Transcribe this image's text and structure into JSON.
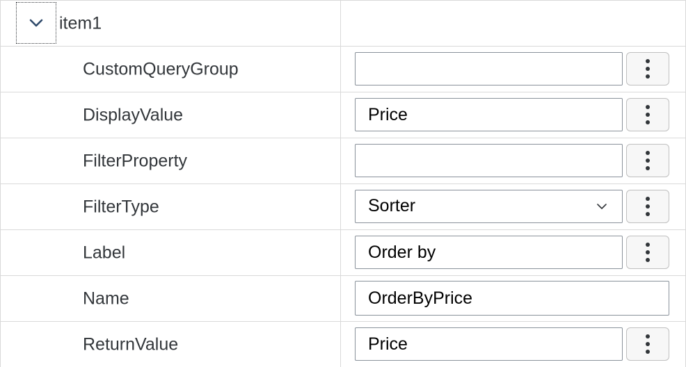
{
  "tree": {
    "node_label": "item1",
    "expander_icon": "chevron-down-icon"
  },
  "properties": [
    {
      "name": "CustomQueryGroup",
      "value": "",
      "control": "text",
      "has_menu": true
    },
    {
      "name": "DisplayValue",
      "value": "Price",
      "control": "text",
      "has_menu": true
    },
    {
      "name": "FilterProperty",
      "value": "",
      "control": "text",
      "has_menu": true
    },
    {
      "name": "FilterType",
      "value": "Sorter",
      "control": "select",
      "has_menu": true
    },
    {
      "name": "Label",
      "value": "Order by",
      "control": "text",
      "has_menu": true
    },
    {
      "name": "Name",
      "value": "OrderByPrice",
      "control": "text",
      "has_menu": false
    },
    {
      "name": "ReturnValue",
      "value": "Price",
      "control": "text",
      "has_menu": true
    }
  ],
  "icons": {
    "menu_icon": "vertical-dots-icon",
    "dropdown_icon": "chevron-down-icon"
  },
  "colors": {
    "text": "#32363a",
    "border": "#d9d9d9",
    "field_border": "#89919a",
    "button_bg": "#f7f7f7"
  }
}
